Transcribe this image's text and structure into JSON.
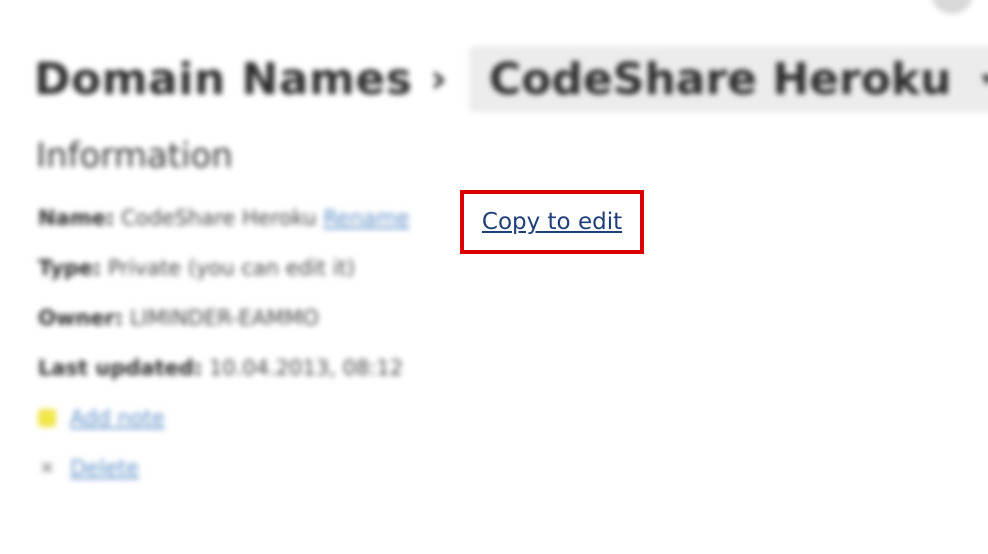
{
  "header": {
    "breadcrumb_parent": "Domain Names",
    "breadcrumb_separator": "›",
    "current_domain": "CodeShare Heroku",
    "chevron": "▾"
  },
  "info": {
    "heading": "Information",
    "rows": [
      {
        "key": "Name:",
        "value": "CodeShare Heroku",
        "link": "Rename"
      },
      {
        "key": "Type:",
        "value": "Private (you can edit it)"
      },
      {
        "key": "Owner:",
        "value": "LIMINDER-EAMMO"
      },
      {
        "key": "Last updated:",
        "value": "10.04.2013, 08:12"
      }
    ]
  },
  "actions": {
    "add_note": "Add note",
    "delete": "Delete"
  },
  "focus": {
    "copy_to_edit": "Copy to edit",
    "highlight_color": "#dd0000",
    "link_color": "#1f3f7a"
  },
  "icons": {
    "star": "star-icon",
    "delete": "x-icon"
  }
}
